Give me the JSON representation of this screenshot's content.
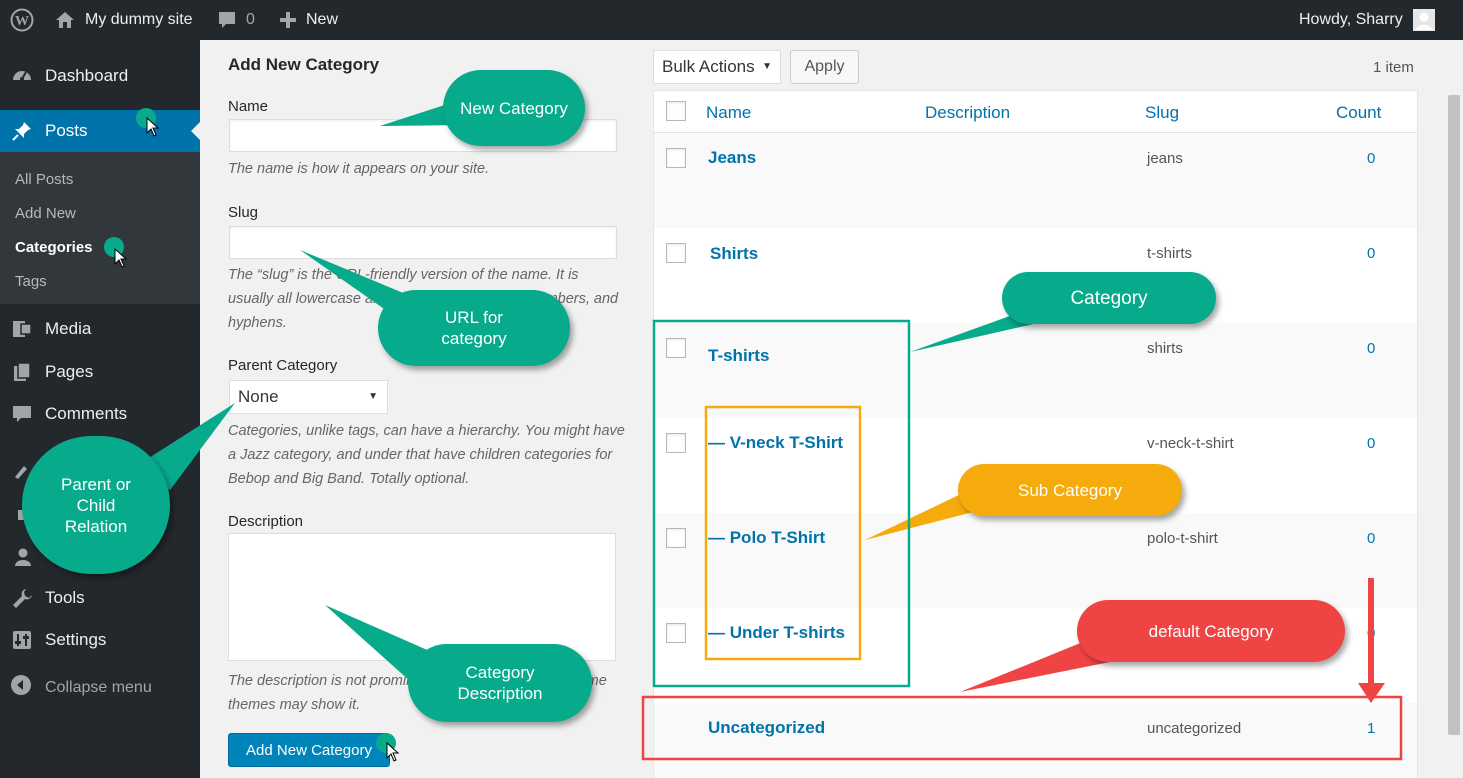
{
  "adminbar": {
    "site_name": "My dummy site",
    "comments_count": "0",
    "new_label": "New",
    "howdy": "Howdy, Sharry"
  },
  "sidebar": {
    "items": [
      {
        "label": "Dashboard",
        "icon": "dashboard-icon"
      },
      {
        "label": "Posts",
        "icon": "pushpin-icon"
      },
      {
        "label": "Media",
        "icon": "media-icon"
      },
      {
        "label": "Pages",
        "icon": "pages-icon"
      },
      {
        "label": "Comments",
        "icon": "comment-icon"
      },
      {
        "label": "Tools",
        "icon": "wrench-icon"
      },
      {
        "label": "Settings",
        "icon": "settings-icon"
      }
    ],
    "submenu": [
      "All Posts",
      "Add New",
      "Categories",
      "Tags"
    ],
    "collapse_label": "Collapse menu"
  },
  "form": {
    "title": "Add New Category",
    "name_label": "Name",
    "name_help": "The name is how it appears on your site.",
    "slug_label": "Slug",
    "slug_help": "The “slug” is the URL-friendly version of the name. It is usually all lowercase and contains only letters, numbers, and hyphens.",
    "parent_label": "Parent Category",
    "parent_value": "None",
    "parent_help": "Categories, unlike tags, can have a hierarchy. You might have a Jazz category, and under that have children categories for Bebop and Big Band. Totally optional.",
    "description_label": "Description",
    "description_help": "The description is not prominent by default; however, some themes may show it.",
    "submit_label": "Add New Category"
  },
  "table": {
    "bulk_actions": "Bulk Actions",
    "apply": "Apply",
    "item_count": "1 item",
    "columns": [
      "Name",
      "Description",
      "Slug",
      "Count"
    ],
    "rows": [
      {
        "name": "Jeans",
        "slug": "jeans",
        "count": "0"
      },
      {
        "name": "Shirts",
        "slug": "t-shirts",
        "count": "0"
      },
      {
        "name": "T-shirts",
        "slug": "shirts",
        "count": "0"
      },
      {
        "name": "— V-neck T-Shirt",
        "slug": "v-neck-t-shirt",
        "count": "0"
      },
      {
        "name": "— Polo T-Shirt",
        "slug": "polo-t-shirt",
        "count": "0"
      },
      {
        "name": "— Under T-shirts",
        "slug": "",
        "count": "0"
      },
      {
        "name": "Uncategorized",
        "slug": "uncategorized",
        "count": "1"
      }
    ]
  },
  "annotations": {
    "new_category": "New Category",
    "url_for_category": "URL for category",
    "parent_child": "Parent or Child Relation",
    "category_description": "Category Description",
    "category": "Category",
    "sub_category": "Sub Category",
    "default_category": "default Category"
  },
  "colors": {
    "accent": "#0073aa",
    "teal": "#07ab8c",
    "orange": "#f5ab0c",
    "red": "#f04444"
  }
}
